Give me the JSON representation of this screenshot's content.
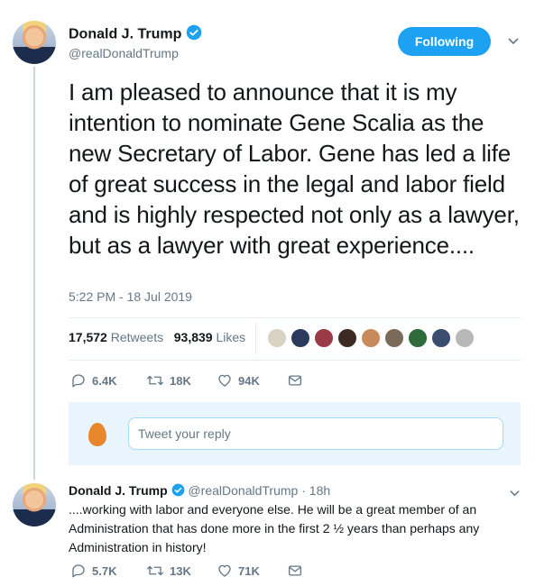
{
  "main_tweet": {
    "author_name": "Donald J. Trump",
    "author_handle": "@realDonaldTrump",
    "follow_label": "Following",
    "text": "I am pleased to announce that it is my intention to nominate Gene Scalia as the new Secretary of Labor. Gene has led a life of great success in the legal and labor field and is highly respected not only as a lawyer, but as a lawyer with great experience....",
    "timestamp": "5:22 PM - 18 Jul 2019",
    "retweets_count": "17,572",
    "retweets_label": "Retweets",
    "likes_count": "93,839",
    "likes_label": "Likes",
    "actions": {
      "replies": "6.4K",
      "retweets": "18K",
      "likes": "94K"
    }
  },
  "reply_composer": {
    "placeholder": "Tweet your reply"
  },
  "reply_tweet": {
    "author_name": "Donald J. Trump",
    "author_handle": "@realDonaldTrump",
    "separator": "·",
    "time_ago": "18h",
    "text": "....working with labor and everyone else. He will be a great member of an Administration that has done more in the first 2 ½ years than perhaps any Administration in history!",
    "actions": {
      "replies": "5.7K",
      "retweets": "13K",
      "likes": "71K"
    }
  },
  "colors": {
    "accent": "#1da1f2",
    "secondary_text": "#657786",
    "divider": "#e6ecf0",
    "reply_bg": "#e8f5fd"
  }
}
